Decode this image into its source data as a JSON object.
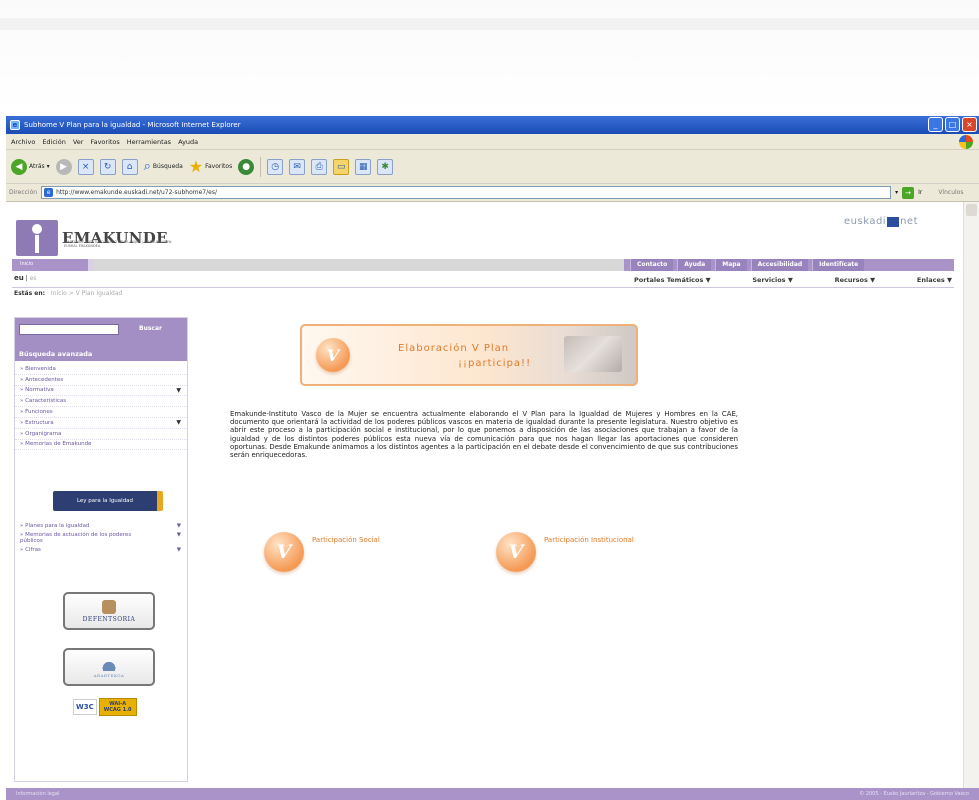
{
  "window": {
    "title": "Subhome V Plan para la igualdad - Microsoft Internet Explorer",
    "menu": [
      "Archivo",
      "Edición",
      "Ver",
      "Favoritos",
      "Herramientas",
      "Ayuda"
    ],
    "toolbar": {
      "back": "Atrás",
      "search": "Búsqueda",
      "favorites": "Favoritos"
    },
    "address_label": "Dirección",
    "address_value": "http://www.emakunde.euskadi.net/u72-subhome7/es/",
    "go_label": "Ir",
    "links_label": "Vínculos"
  },
  "page": {
    "logo_text": "EMAKUNDE",
    "logo_sub": "EMAKUNDE-INSTITUTO VASCO DE LA MUJER / EMAKUMEAREN EUSKAL ERAKUNDEA",
    "euskadi_brand": "euskadi",
    "euskadi_suffix": "net",
    "home_label": "Inicio",
    "top_links": [
      "Contacto",
      "Ayuda",
      "Mapa",
      "Accesibilidad",
      "Identifícate"
    ],
    "lang": {
      "active": "eu",
      "other": "es"
    },
    "menus": [
      "Portales Temáticos ▼",
      "Servicios ▼",
      "Recursos ▼",
      "Enlaces ▼"
    ],
    "breadcrumb_label": "Estás en:",
    "breadcrumb_path": "Inicio > V Plan Igualdad"
  },
  "sidebar": {
    "search_button": "Buscar",
    "advanced_search": "Búsqueda avanzada",
    "items": [
      {
        "label": "Bienvenida",
        "arrow": ""
      },
      {
        "label": "Antecedentes",
        "arrow": ""
      },
      {
        "label": "Normativa",
        "arrow": "▼"
      },
      {
        "label": "Características",
        "arrow": ""
      },
      {
        "label": "Funciones",
        "arrow": ""
      },
      {
        "label": "Estructura",
        "arrow": "▼"
      },
      {
        "label": "Organigrama",
        "arrow": ""
      },
      {
        "label": "Memorias de Emakunde",
        "arrow": ""
      }
    ],
    "ley_button": "Ley para la Igualdad",
    "items2": [
      {
        "label": "Planes para la igualdad",
        "arrow": "▼"
      },
      {
        "label": "Memorias de actuación de los poderes públicos",
        "arrow": "▼"
      },
      {
        "label": "Cifras",
        "arrow": "▼"
      }
    ],
    "badge1": "DEFENTSORIA",
    "badge2": "ARARTEKOA",
    "wai_w3c": "W3C",
    "wai_level": "WAI-A",
    "wai_version": "WCAG 1.0"
  },
  "main": {
    "banner_line1": "Elaboración V Plan",
    "banner_line2": "¡¡participa!!",
    "banner_letter": "V",
    "paragraph": "Emakunde-Instituto Vasco de la Mujer se encuentra actualmente elaborando el V Plan para la Igualdad de Mujeres y Hombres en la CAE, documento que orientará la actividad de los poderes públicos vascos en materia de igualdad durante la presente legislatura. Nuestro objetivo es abrir este proceso a la participación social e institucional, por lo que ponemos a disposición de las asociaciones que trabajan a favor de la igualdad y de los distintos poderes públicos esta nueva vía de comunicación para que nos hagan llegar las aportaciones que consideren oportunas. Desde Emakunde animamos a los distintos agentes a la participación en el debate desde el convencimiento de que sus contribuciones serán enriquecedoras.",
    "social_label": "Participación Social",
    "institutional_label": "Participación Institucional"
  },
  "footer": {
    "left": "Información legal",
    "right": "© 2005 - Eusko Jaurlaritza - Gobierno Vasco"
  },
  "colors": {
    "purple": "#a993c9",
    "orange": "#e07a2a",
    "navy": "#2d3e73",
    "xp_blue": "#1b4cb5"
  }
}
